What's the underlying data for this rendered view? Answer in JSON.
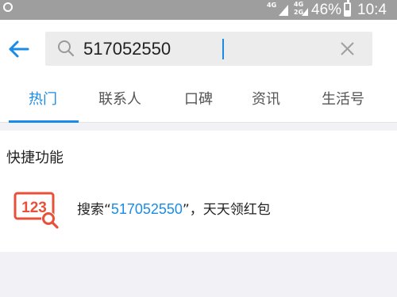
{
  "status_bar": {
    "network_1": "4G",
    "network_2": "4G",
    "network_2_sub": "2G",
    "battery_percent": "46%",
    "battery_level": 0.46,
    "time": "10:4"
  },
  "header": {
    "search_value": "517052550"
  },
  "tabs": [
    {
      "label": "热门",
      "active": true
    },
    {
      "label": "联系人",
      "active": false
    },
    {
      "label": "口碑",
      "active": false
    },
    {
      "label": "资讯",
      "active": false
    },
    {
      "label": "生活号",
      "active": false
    }
  ],
  "quick_functions": {
    "title": "快捷功能",
    "item": {
      "icon_text": "123",
      "prefix": "搜索“",
      "highlight": "517052550",
      "suffix": "”，天天领红包"
    }
  },
  "colors": {
    "accent": "#1a8ce8",
    "icon_red": "#e8503a",
    "status_bar": "#9e9e9e"
  }
}
